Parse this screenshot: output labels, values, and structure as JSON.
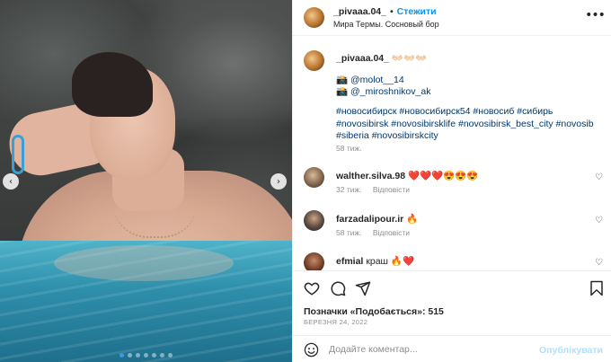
{
  "photo": {
    "prev_glyph": "‹",
    "next_glyph": "›",
    "dots_count": 7,
    "active_dot": 0
  },
  "header": {
    "username": "_pivaaa.04_",
    "separator": "•",
    "follow_label": "Стежити",
    "location": "Мира Термы. Сосновый бор",
    "more_glyph": "•••"
  },
  "caption": {
    "username": "_pivaaa.04_",
    "emoji": "👐🏻👐🏻👐🏻",
    "line1_icon": "📸",
    "line1_mention": "@molot__14",
    "line2_icon": "📸",
    "line2_mention": "@_miroshnikov_ak",
    "hashtags": "#новосибирск #новосибирск54 #новосиб #сибирь #novosibirsk #novosibirsklife #novosibirsk_best_city #novosib #siberia #novosibirskcity",
    "time": "58 тиж."
  },
  "comments": [
    {
      "user": "walther.silva.98",
      "text": "❤️❤️❤️😍😍😍",
      "time": "32 тиж.",
      "reply": "Відповісти"
    },
    {
      "user": "farzadalipour.ir",
      "text": "🔥",
      "time": "58 тиж.",
      "reply": "Відповісти"
    },
    {
      "user": "efmial",
      "text": "краш 🔥❤️",
      "time": "",
      "reply": ""
    }
  ],
  "likes": {
    "label": "Позначки «Подобається»: 515"
  },
  "date": "БЕРЕЗНЯ 24, 2022",
  "comment_box": {
    "placeholder": "Додайте коментар...",
    "publish_label": "Опублікувати"
  },
  "colors": {
    "accent": "#0095f6",
    "publish_disabled": "#b2dffc",
    "link": "#00376b",
    "muted": "#8e8e8e"
  }
}
